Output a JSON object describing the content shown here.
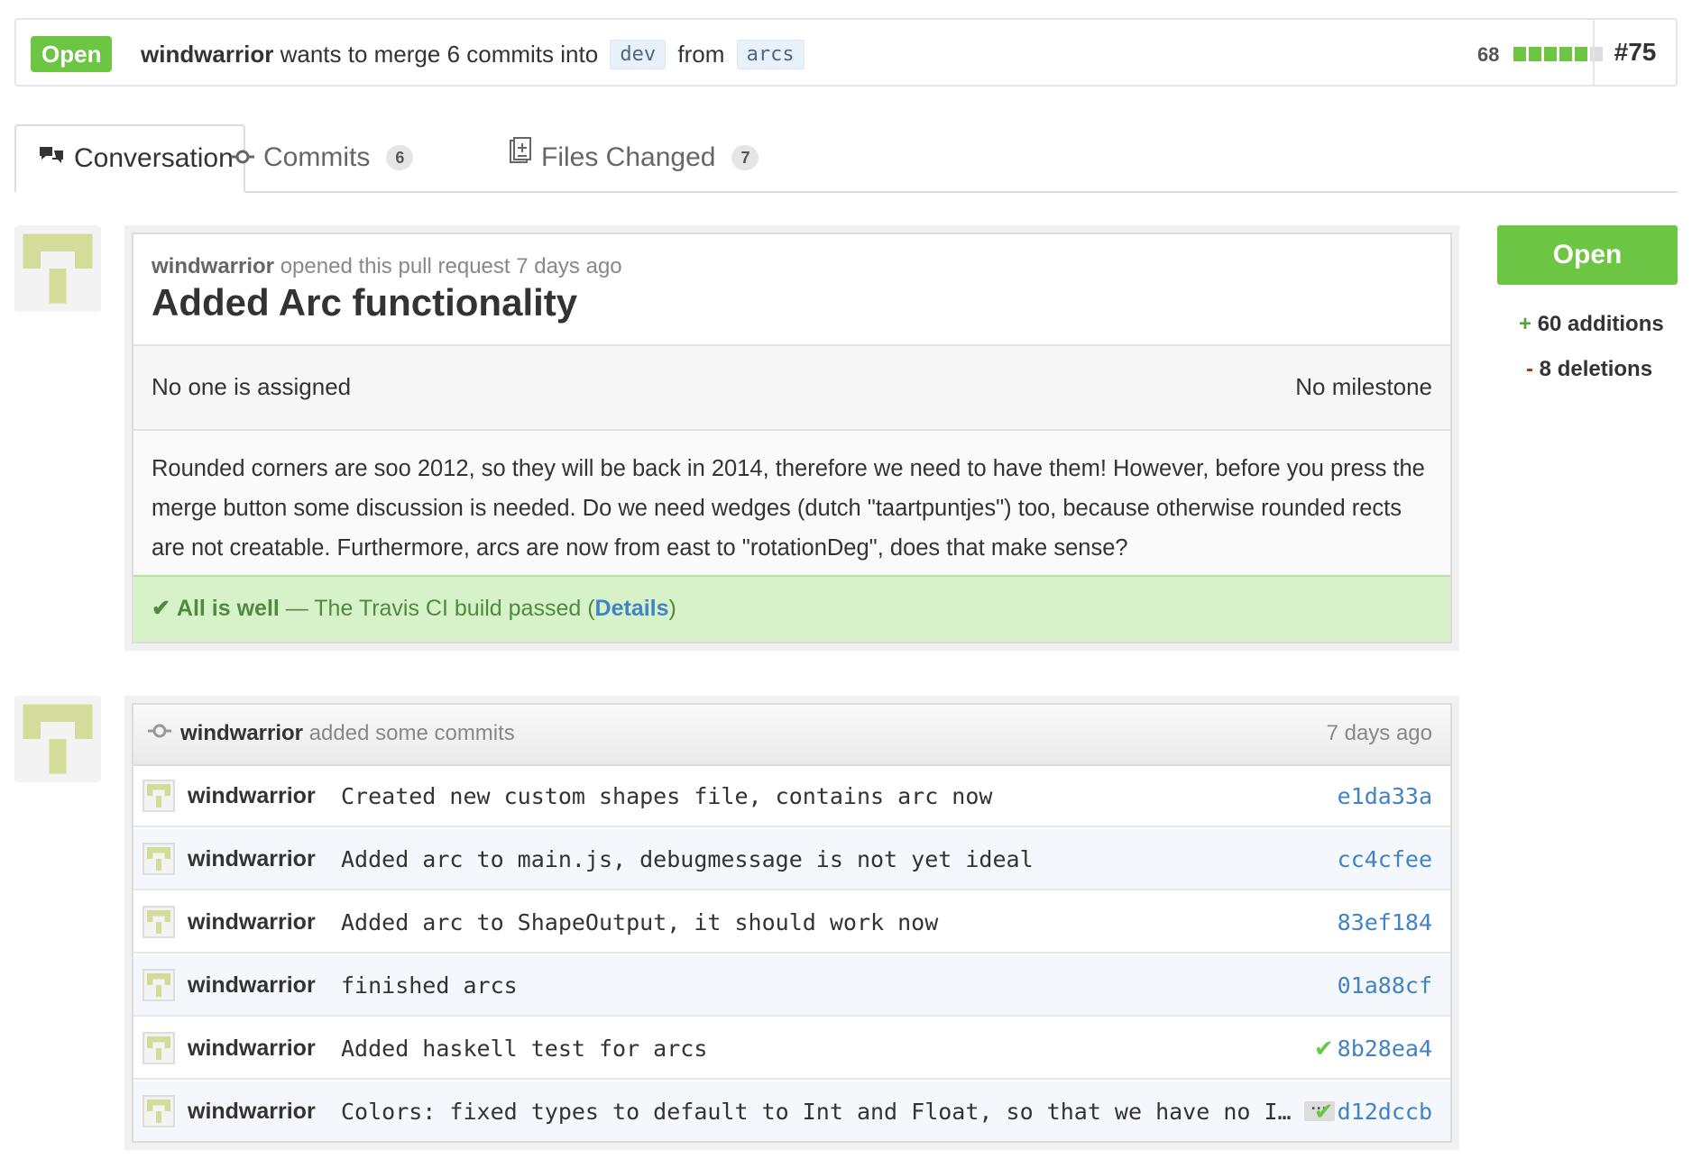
{
  "header": {
    "state": "Open",
    "author": "windwarrior",
    "merge_text": "wants to merge 6 commits into",
    "base_branch": "dev",
    "from_text": "from",
    "head_branch": "arcs",
    "diffstat_count": "68",
    "diffstat_colors": [
      "#6cc644",
      "#6cc644",
      "#6cc644",
      "#6cc644",
      "#6cc644",
      "#dddddd"
    ],
    "pr_number": "#75"
  },
  "tabs": [
    {
      "label": "Conversation",
      "icon": "comment-discussion-icon",
      "count": ""
    },
    {
      "label": "Commits",
      "icon": "git-commit-icon",
      "count": "6"
    },
    {
      "label": "Files Changed",
      "icon": "diff-icon",
      "count": "7"
    }
  ],
  "discussion": {
    "author": "windwarrior",
    "opened_text": "opened this pull request 7 days ago",
    "title": "Added Arc functionality",
    "assignee": "No one is assigned",
    "milestone": "No milestone",
    "body": "Rounded corners are soo 2012, so they will be back in 2014, therefore we need to have them! However, before you press the merge button some discussion is needed. Do we need wedges (dutch \"taartpuntjes\") too, because otherwise rounded rects are not creatable. Furthermore, arcs are now from east to \"rotationDeg\", does that make sense?",
    "ci_strong": "All is well",
    "ci_text": "— The Travis CI build passed (",
    "ci_link": "Details",
    "ci_close": ")"
  },
  "sidebar": {
    "state_button": "Open",
    "additions_sign": "+",
    "additions": "60 additions",
    "deletions_sign": "-",
    "deletions": "8 deletions"
  },
  "commits": {
    "author": "windwarrior",
    "action": "added some commits",
    "time": "7 days ago",
    "items": [
      {
        "author": "windwarrior",
        "message": "Created new custom shapes file, contains arc now",
        "sha": "e1da33a",
        "status": ""
      },
      {
        "author": "windwarrior",
        "message": "Added arc to main.js, debugmessage is not yet ideal",
        "sha": "cc4cfee",
        "status": ""
      },
      {
        "author": "windwarrior",
        "message": "Added arc to ShapeOutput, it should work now",
        "sha": "83ef184",
        "status": ""
      },
      {
        "author": "windwarrior",
        "message": "finished arcs",
        "sha": "01a88cf",
        "status": ""
      },
      {
        "author": "windwarrior",
        "message": "Added haskell test for arcs",
        "sha": "8b28ea4",
        "status": "✔"
      },
      {
        "author": "windwarrior",
        "message": "Colors: fixed types to default to Int and Float, so that we have no I…",
        "sha": "d12dccb",
        "status": "✔",
        "more": "···"
      }
    ]
  }
}
